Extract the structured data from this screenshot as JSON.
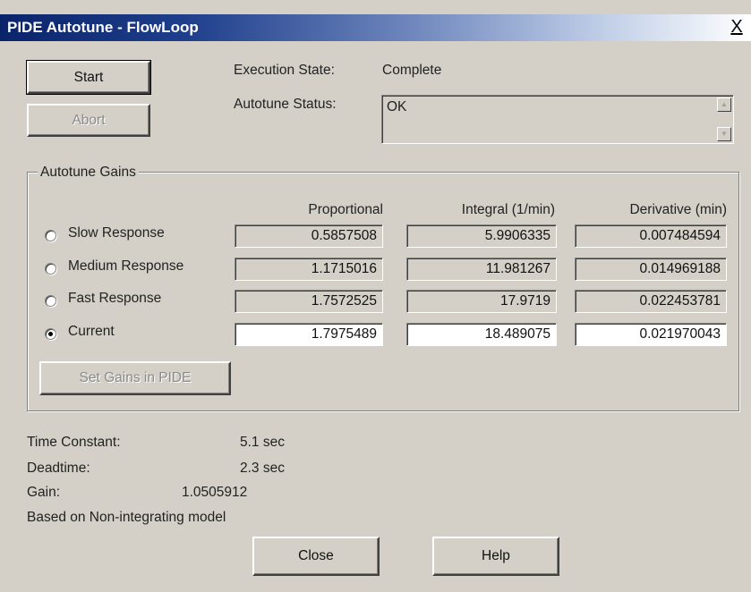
{
  "window": {
    "title": "PIDE Autotune - FlowLoop",
    "close_glyph": "X"
  },
  "buttons": {
    "start": "Start",
    "abort": "Abort",
    "set_gains": "Set Gains in PIDE",
    "close": "Close",
    "help": "Help"
  },
  "execution": {
    "label": "Execution State:",
    "value": "Complete"
  },
  "autotune_status": {
    "label": "Autotune Status:",
    "value": "OK"
  },
  "gains": {
    "group_title": "Autotune Gains",
    "headers": [
      "Proportional",
      "Integral (1/min)",
      "Derivative (min)"
    ],
    "rows": [
      {
        "label": "Slow Response",
        "selected": false,
        "editable": false,
        "values": [
          "0.5857508",
          "5.9906335",
          "0.007484594"
        ]
      },
      {
        "label": "Medium Response",
        "selected": false,
        "editable": false,
        "values": [
          "1.1715016",
          "11.981267",
          "0.014969188"
        ]
      },
      {
        "label": "Fast Response",
        "selected": false,
        "editable": false,
        "values": [
          "1.7572525",
          "17.9719",
          "0.022453781"
        ]
      },
      {
        "label": "Current",
        "selected": true,
        "editable": true,
        "values": [
          "1.7975489",
          "18.489075",
          "0.021970043"
        ]
      }
    ]
  },
  "model": {
    "time_constant_label": "Time Constant:",
    "time_constant_value": "5.1 sec",
    "deadtime_label": "Deadtime:",
    "deadtime_value": "2.3 sec",
    "gain_label": "Gain:",
    "gain_value": "1.0505912",
    "note": "Based on Non-integrating model"
  }
}
